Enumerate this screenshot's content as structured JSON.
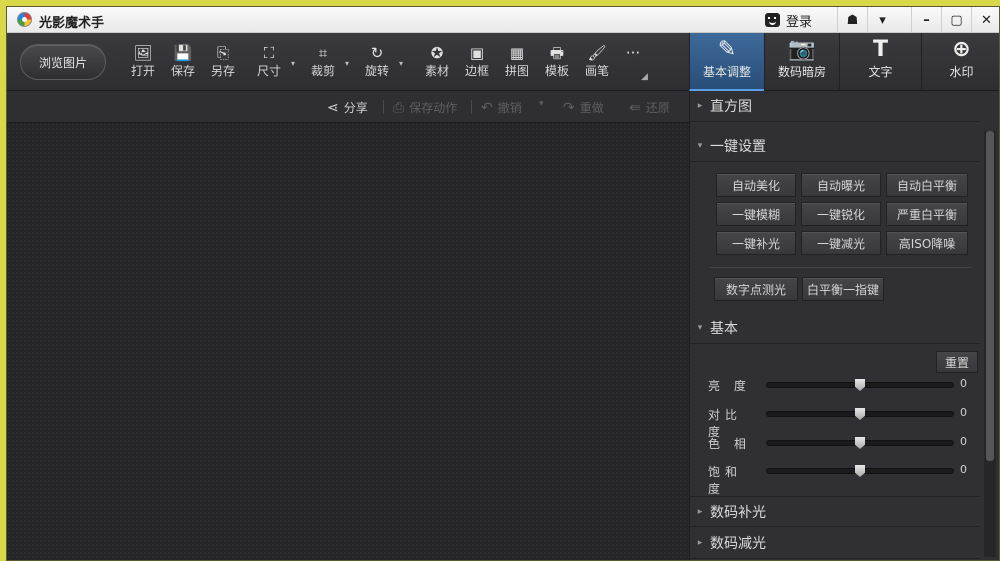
{
  "app": {
    "title": "光影魔术手",
    "login_label": "登录"
  },
  "window_controls": {
    "skin": "☗",
    "menu": "▾",
    "minimize": "–",
    "maximize": "▢",
    "close": "✕"
  },
  "toolbar": {
    "browse_label": "浏览图片",
    "tools": [
      {
        "id": "open",
        "label": "打开",
        "icon": "🖼"
      },
      {
        "id": "save",
        "label": "保存",
        "icon": "💾"
      },
      {
        "id": "save-as",
        "label": "另存",
        "icon": "⎘"
      },
      {
        "id": "size",
        "label": "尺寸",
        "icon": "⛶"
      },
      {
        "id": "crop",
        "label": "裁剪",
        "icon": "⌗"
      },
      {
        "id": "rotate",
        "label": "旋转",
        "icon": "↻"
      },
      {
        "id": "material",
        "label": "素材",
        "icon": "✪"
      },
      {
        "id": "border",
        "label": "边框",
        "icon": "▣"
      },
      {
        "id": "collage",
        "label": "拼图",
        "icon": "▦"
      },
      {
        "id": "template",
        "label": "模板",
        "icon": "🖶"
      },
      {
        "id": "brush",
        "label": "画笔",
        "icon": "🖌"
      },
      {
        "id": "more",
        "label": "",
        "icon": "···"
      }
    ],
    "dropdown_arrow": "▾",
    "expand_mark": "◢"
  },
  "right_tabs": [
    {
      "id": "basic",
      "label": "基本调整",
      "icon": "✎",
      "active": true
    },
    {
      "id": "darkroom",
      "label": "数码暗房",
      "icon": "📷",
      "active": false
    },
    {
      "id": "text",
      "label": "文字",
      "icon": "T",
      "active": false
    },
    {
      "id": "watermark",
      "label": "水印",
      "icon": "⊕",
      "active": false
    }
  ],
  "actions": [
    {
      "id": "share",
      "label": "分享",
      "icon": "⋖",
      "enabled": true
    },
    {
      "id": "save-action",
      "label": "保存动作",
      "icon": "⎙",
      "enabled": false
    },
    {
      "id": "undo",
      "label": "撤销",
      "icon": "↶",
      "enabled": false
    },
    {
      "id": "redo",
      "label": "重做",
      "icon": "↷",
      "enabled": false
    },
    {
      "id": "restore",
      "label": "还原",
      "icon": "⇚",
      "enabled": false
    }
  ],
  "panel": {
    "histogram": "直方图",
    "one_click": {
      "title": "一键设置",
      "buttons": [
        "自动美化",
        "自动曝光",
        "自动白平衡",
        "一键模糊",
        "一键锐化",
        "严重白平衡",
        "一键补光",
        "一键减光",
        "高ISO降噪"
      ],
      "extra_buttons": [
        "数字点测光",
        "白平衡一指键"
      ]
    },
    "basic": {
      "title": "基本",
      "reset": "重置",
      "sliders": [
        {
          "label": "亮 度",
          "value": 0
        },
        {
          "label": "对比度",
          "value": 0
        },
        {
          "label": "色 相",
          "value": 0
        },
        {
          "label": "饱和度",
          "value": 0
        }
      ]
    },
    "fill_light": "数码补光",
    "reduce_light": "数码减光"
  },
  "colors": {
    "accent": "#3e6a9a",
    "canvas": "#252528",
    "panel": "#303034"
  }
}
